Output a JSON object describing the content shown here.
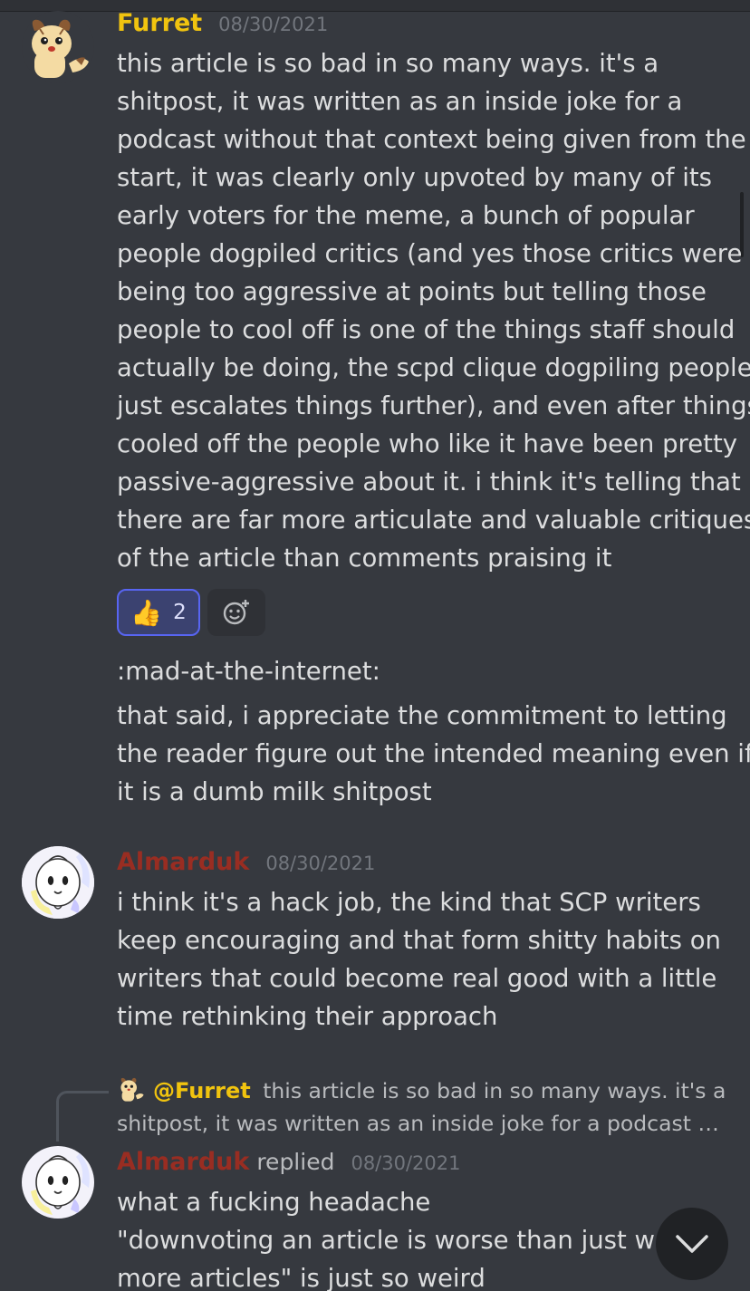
{
  "messages": [
    {
      "author": "Furret",
      "timestamp": "08/30/2021",
      "lines": [
        "this article is so bad in so many ways. it's a",
        "shitpost, it was written as an inside joke for a",
        "podcast without that context being given from the",
        "start, it was clearly only upvoted by many of its",
        "early voters for the meme, a bunch of popular",
        "people dogpiled critics (and yes those critics were",
        "being too aggressive at points but telling those",
        "people to cool off is one of the things staff should",
        "actually be doing, the scpd clique dogpiling people",
        "just escalates things further), and even after things",
        "cooled off the people who like it have been pretty",
        "passive-aggressive about it. i think it's telling that",
        "there are far more articulate and valuable critiques",
        "of the article than comments praising it"
      ],
      "reaction": {
        "emoji": "👍",
        "count": "2"
      },
      "followup_1": ":mad-at-the-internet:",
      "followup_2_lines": [
        "that said, i appreciate the commitment to letting",
        "the reader figure out the intended meaning even if",
        "it is a dumb milk shitpost"
      ]
    },
    {
      "author": "Almarduk",
      "timestamp": "08/30/2021",
      "lines": [
        "i think it's a hack job, the kind that SCP writers",
        "keep encouraging and that form shitty habits on",
        "writers that could become real good with a little",
        "time rethinking their approach"
      ]
    },
    {
      "reply_to": {
        "mention": "@Furret",
        "line1": "this article is so bad in so many ways. it's a",
        "line2": "shitpost, it was written as an inside joke for a podcast …"
      },
      "author": "Almarduk",
      "replied_label": "replied",
      "timestamp": "08/30/2021",
      "lines": [
        "what a fucking headache",
        "\"downvoting an article is worse than just writ",
        "more articles\" is just so weird"
      ]
    }
  ],
  "icons": {
    "add_reaction": "add-reaction-icon",
    "jump_to_present": "chevron-down-icon"
  },
  "colors": {
    "background": "#36393f",
    "furret_name": "#f1c40f",
    "almarduk_name": "#992d22",
    "reaction_border": "#5865f2"
  }
}
